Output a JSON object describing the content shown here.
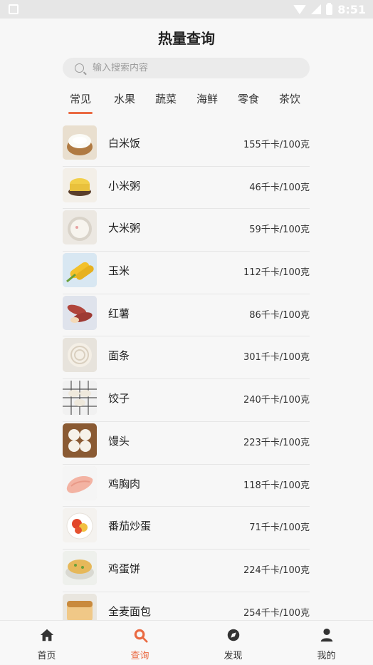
{
  "status": {
    "time": "8:51"
  },
  "header": {
    "title": "热量查询"
  },
  "search": {
    "placeholder": "输入搜索内容"
  },
  "tabs": [
    {
      "label": "常见",
      "active": true
    },
    {
      "label": "水果"
    },
    {
      "label": "蔬菜"
    },
    {
      "label": "海鲜"
    },
    {
      "label": "零食"
    },
    {
      "label": "茶饮"
    }
  ],
  "foods": [
    {
      "name": "白米饭",
      "calories": "155千卡/100克",
      "icon": "rice-bowl"
    },
    {
      "name": "小米粥",
      "calories": "46千卡/100克",
      "icon": "millet-porridge"
    },
    {
      "name": "大米粥",
      "calories": "59千卡/100克",
      "icon": "rice-porridge"
    },
    {
      "name": "玉米",
      "calories": "112千卡/100克",
      "icon": "corn"
    },
    {
      "name": "红薯",
      "calories": "86千卡/100克",
      "icon": "sweet-potato"
    },
    {
      "name": "面条",
      "calories": "301千卡/100克",
      "icon": "noodles"
    },
    {
      "name": "饺子",
      "calories": "240千卡/100克",
      "icon": "dumplings"
    },
    {
      "name": "馒头",
      "calories": "223千卡/100克",
      "icon": "steamed-bun"
    },
    {
      "name": "鸡胸肉",
      "calories": "118千卡/100克",
      "icon": "chicken-breast"
    },
    {
      "name": "番茄炒蛋",
      "calories": "71千卡/100克",
      "icon": "tomato-egg"
    },
    {
      "name": "鸡蛋饼",
      "calories": "224千卡/100克",
      "icon": "egg-pancake"
    },
    {
      "name": "全麦面包",
      "calories": "254千卡/100克",
      "icon": "whole-wheat-bread"
    }
  ],
  "bottom_nav": [
    {
      "label": "首页",
      "icon": "home-icon"
    },
    {
      "label": "查询",
      "icon": "search-food-icon",
      "active": true
    },
    {
      "label": "发现",
      "icon": "discover-icon"
    },
    {
      "label": "我的",
      "icon": "profile-icon"
    }
  ],
  "colors": {
    "accent": "#ea6a42",
    "text": "#222222",
    "background": "#f7f7f7"
  }
}
